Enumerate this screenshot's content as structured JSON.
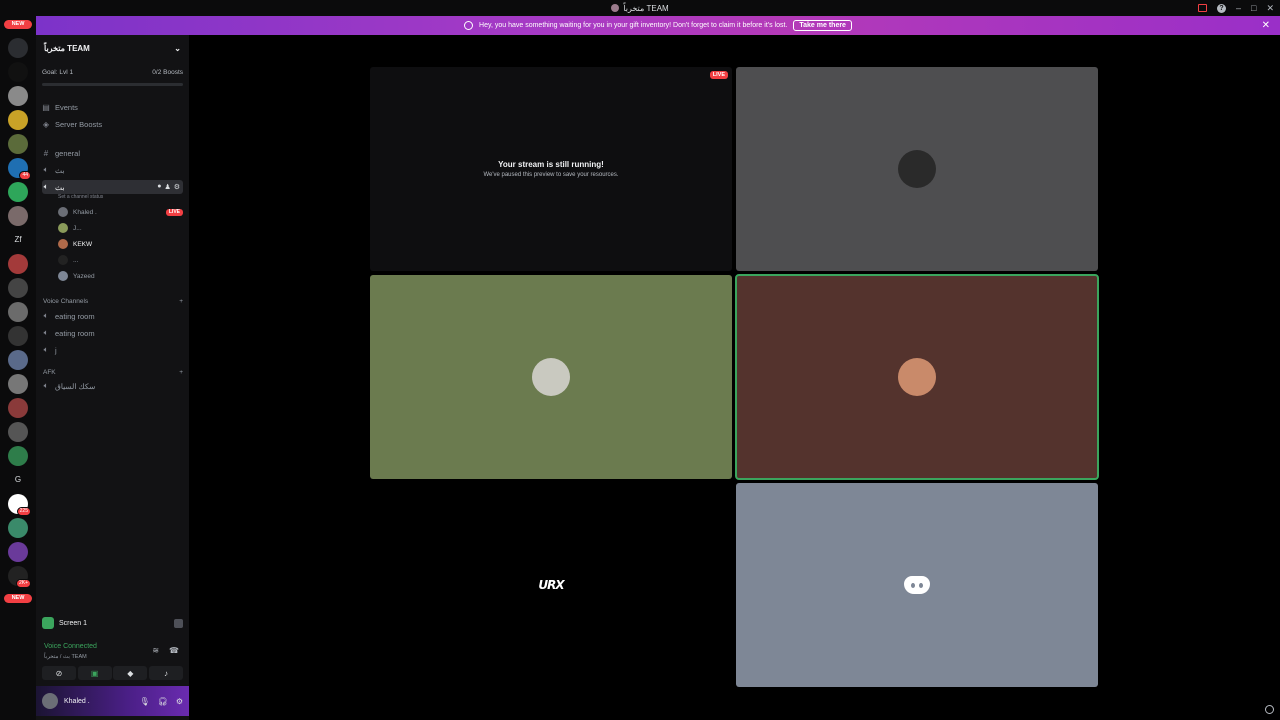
{
  "window": {
    "title": "متخرباً TEAM"
  },
  "banner": {
    "message": "Hey, you have something waiting for you in your gift inventory! Don't forget to claim it before it's lost.",
    "button": "Take me there"
  },
  "guild_bar": {
    "new_top": "NEW",
    "new_bottom": "NEW",
    "letters": [
      "Zf",
      "G"
    ],
    "badges": [
      "44",
      "225",
      "2K+"
    ]
  },
  "server": {
    "name": "متخرباً TEAM",
    "goal": "Goal: Lvl 1",
    "boosts": "0/2 Boosts",
    "items": [
      {
        "label": "Events",
        "icon": "calendar-icon"
      },
      {
        "label": "Server Boosts",
        "icon": "boost-icon"
      }
    ],
    "channels": {
      "general": "general",
      "voice1": "بث",
      "voice2": "بث",
      "channel_status": "Set a channel status"
    },
    "voice_users": [
      {
        "name": "Khaled .",
        "live": "LIVE"
      },
      {
        "name": "J..."
      },
      {
        "name": "KEKW"
      },
      {
        "name": "..."
      },
      {
        "name": "Yazeed"
      }
    ],
    "category_voice": "Voice Channels",
    "voice_channels": [
      "eating room",
      "eating room",
      "j"
    ],
    "category_afk": "AFK",
    "afk_channel": "سكك السياق"
  },
  "panel": {
    "screen_label": "Screen 1",
    "voice_connected": "Voice Connected",
    "voice_sub": "بث / متخرباً TEAM",
    "user_name": "Khaled ."
  },
  "stage": {
    "paused_title": "Your stream is still running!",
    "paused_sub": "We've paused this preview to save your resources.",
    "live_label": "LIVE",
    "brand_logo": "URX"
  },
  "colors": {
    "tile_gray": "#4e4e50",
    "tile_green": "#6b7b4f",
    "tile_brown": "#54332d",
    "tile_blue": "#7e8796",
    "accent": "#5865f2",
    "live_red": "#f23f43",
    "speaking_green": "#3ba55d"
  }
}
